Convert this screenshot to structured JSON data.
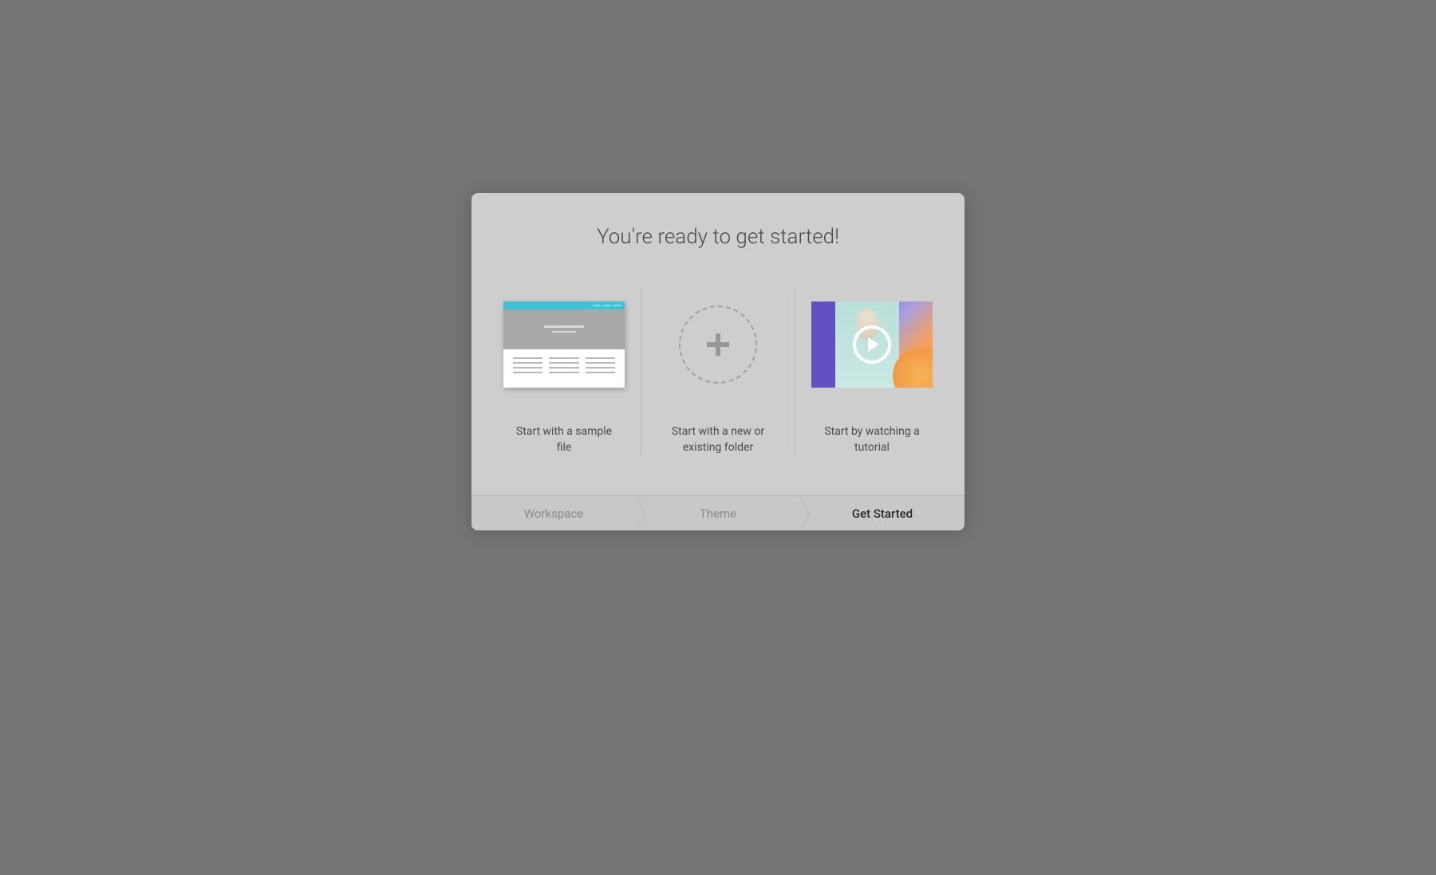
{
  "modal": {
    "title": "You're ready to get started!",
    "options": [
      {
        "label": "Start with a sample file"
      },
      {
        "label": "Start with a new or existing folder"
      },
      {
        "label": "Start by watching a tutorial"
      }
    ],
    "steps": [
      {
        "label": "Workspace",
        "active": false
      },
      {
        "label": "Theme",
        "active": false
      },
      {
        "label": "Get Started",
        "active": true
      }
    ]
  }
}
